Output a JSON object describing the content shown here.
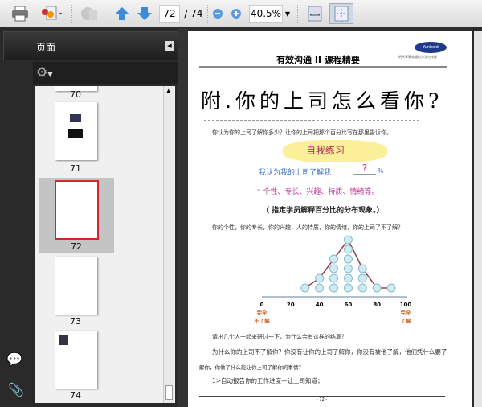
{
  "toolbar": {
    "current_page": "72",
    "total_pages": "/ 74",
    "zoom": "40.5%"
  },
  "sidebar": {
    "title": "页面",
    "thumbnails": [
      {
        "label": "70"
      },
      {
        "label": "71"
      },
      {
        "label": "72",
        "selected": true
      },
      {
        "label": "73"
      },
      {
        "label": "74"
      }
    ]
  },
  "page": {
    "header_title": "有效沟通 II 课程精要",
    "logo_text": "Yunhold",
    "logo_sub": "把共享高效通的方法与技能",
    "title": "附.你的上司怎么看你?",
    "intro": "你认为你的上司了解你多少？让你的上司把那个百分比写在那里告诉你。",
    "exercise_heading": "自我练习",
    "exercise_line": "我认为我的上司了解我",
    "exercise_blank": "?",
    "exercise_pct": "%",
    "traits": "* 个性、专长、兴趣、特质、情绪等。",
    "instruction": "（ 指定学员解释百分比的分布现象。）",
    "question": "你的个性，你的专长，你的兴趣，人的特质，你的情绪，你的上司了不了解？",
    "chart": {
      "type": "scatter",
      "x_ticks": [
        "0",
        "20",
        "40",
        "60",
        "80",
        "100"
      ],
      "xlim": [
        0,
        100
      ],
      "columns": [
        {
          "x": 30,
          "count": 1
        },
        {
          "x": 40,
          "count": 2
        },
        {
          "x": 50,
          "count": 4
        },
        {
          "x": 60,
          "count": 6
        },
        {
          "x": 70,
          "count": 3
        },
        {
          "x": 80,
          "count": 1
        },
        {
          "x": 90,
          "count": 1
        }
      ],
      "left_label": [
        "完全",
        "不了解"
      ],
      "right_label": [
        "完全",
        "了解"
      ]
    },
    "para1": "请出几个人一起来研讨一下，为什么会有这样的结局？",
    "para2": "为什么你的上司不了解你？你没有让你的上司了解你，你没有被他了解，他们凭什么要了",
    "para3": "解你，你做了什么能让你上司了解你的事情？",
    "para4": "1>自动报告你的工作进度—让上司知道；",
    "page_number": "- 72 -"
  },
  "colors": {
    "accent_red": "#d4262b",
    "chart_line": "#9c3a4a",
    "dot": "#cfeaf2",
    "label_orange": "#c8652a"
  }
}
